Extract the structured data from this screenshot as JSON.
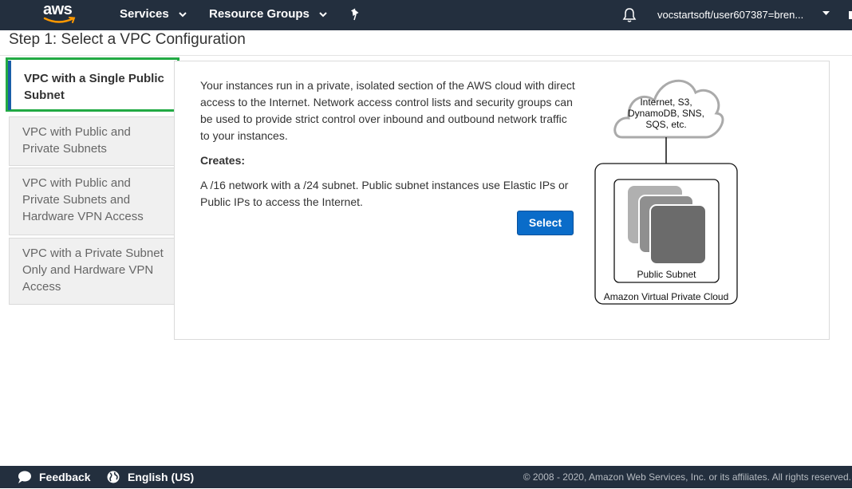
{
  "nav": {
    "logo_text": "aws",
    "services_label": "Services",
    "resource_groups_label": "Resource Groups",
    "account_label": "vocstartsoft/user607387=bren..."
  },
  "page": {
    "title": "Step 1: Select a VPC Configuration"
  },
  "options": [
    {
      "label": "VPC with a Single Public Subnet",
      "selected": true
    },
    {
      "label": "VPC with Public and Private Subnets",
      "selected": false
    },
    {
      "label": "VPC with Public and Private Subnets and Hardware VPN Access",
      "selected": false
    },
    {
      "label": "VPC with a Private Subnet Only and Hardware VPN Access",
      "selected": false
    }
  ],
  "content": {
    "description": "Your instances run in a private, isolated section of the AWS cloud with direct access to the Internet. Network access control lists and security groups can be used to provide strict control over inbound and outbound network traffic to your instances.",
    "creates_label": "Creates:",
    "creates_detail": "A /16 network with a /24 subnet. Public subnet instances use Elastic IPs or Public IPs to access the Internet.",
    "select_label": "Select"
  },
  "diagram": {
    "cloud_line1": "Internet, S3,",
    "cloud_line2": "DynamoDB, SNS,",
    "cloud_line3": "SQS, etc.",
    "subnet_label": "Public Subnet",
    "vpc_label": "Amazon Virtual Private Cloud"
  },
  "footer": {
    "feedback_label": "Feedback",
    "language_label": "English (US)",
    "copyright": "© 2008 - 2020, Amazon Web Services, Inc. or its affiliates. All rights reserved."
  },
  "colors": {
    "nav_bg": "#232f3e",
    "primary_button": "#0a6cc9",
    "selected_highlight": "#22aa44",
    "selected_bar": "#1a5fa8"
  },
  "icons": [
    "aws-logo",
    "chevron-down-icon",
    "pin-icon",
    "bell-icon",
    "feedback-icon",
    "globe-icon"
  ]
}
